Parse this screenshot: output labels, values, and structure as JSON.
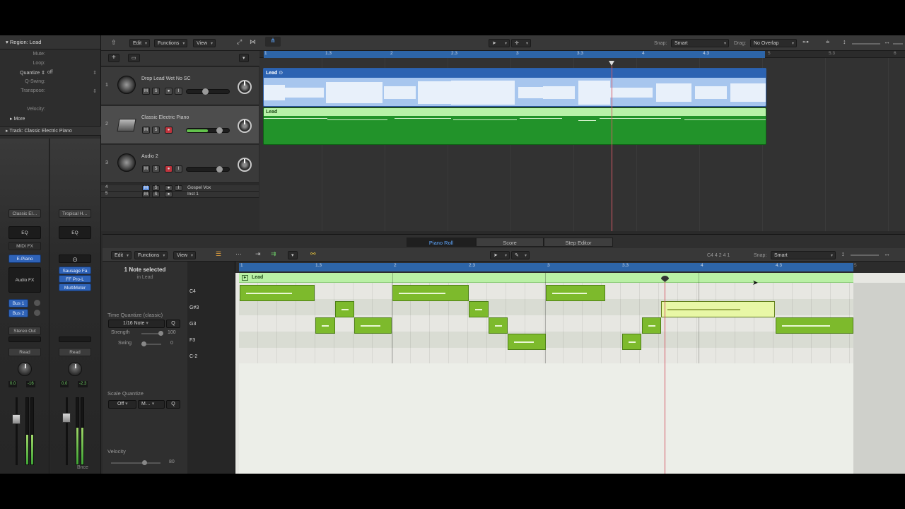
{
  "inspector": {
    "region_header": "Region: Lead",
    "mute_label": "Mute:",
    "loop_label": "Loop:",
    "quantize_label": "Quantize ⇕",
    "quantize_value": "off",
    "qswing_label": "Q-Swing:",
    "transpose_label": "Transpose:",
    "velocity_label": "Velocity:",
    "more_label": "More",
    "track_header": "Track: Classic Electric Piano"
  },
  "strip1": {
    "setting": "Classic El…",
    "eq": "EQ",
    "midi_fx": "MIDI FX",
    "instrument": "E-Piano",
    "audio_fx": "Audio FX",
    "send1": "Bus 1",
    "send2": "Bus 2",
    "output": "Stereo Out",
    "automation": "Read",
    "level_a": "0.0",
    "level_b": "-16"
  },
  "strip2": {
    "setting": "Tropical H…",
    "eq": "EQ",
    "fx": [
      "Sausage Fa",
      "FF Pro-L",
      "MultiMeter"
    ],
    "automation": "Read",
    "level_a": "0.0",
    "level_b": "-2.3",
    "bottom": "Bnce"
  },
  "arrange_toolbar": {
    "edit": "Edit",
    "functions": "Functions",
    "view": "View",
    "snap_label": "Snap:",
    "snap_value": "Smart",
    "drag_label": "Drag:",
    "drag_value": "No Overlap"
  },
  "ruler": [
    "1",
    "1.3",
    "2",
    "2.3",
    "3",
    "3.3",
    "4",
    "4.3",
    "5",
    "5.3",
    "6"
  ],
  "tracks": [
    {
      "num": "1",
      "name": "Drop Lead Wet No SC",
      "m": "M",
      "s": "S",
      "i": "I"
    },
    {
      "num": "2",
      "name": "Classic Electric Piano",
      "m": "M",
      "s": "S"
    },
    {
      "num": "3",
      "name": "Audio 2",
      "m": "M",
      "s": "S",
      "i": "I"
    },
    {
      "num": "4",
      "name": "Gospel Vox",
      "m": "M",
      "s": "S",
      "i": "I"
    },
    {
      "num": "5",
      "name": "Inst 1",
      "m": "M",
      "s": "S"
    }
  ],
  "regions": {
    "audio_name": "Lead",
    "midi_name": "Lead"
  },
  "editor_tabs": [
    "Piano Roll",
    "Score",
    "Step Editor"
  ],
  "piano_roll": {
    "edit": "Edit",
    "functions": "Functions",
    "view": "View",
    "position": "C4  4 2 4 1",
    "snap_label": "Snap:",
    "snap_value": "Smart",
    "selection": "1 Note selected",
    "selection_sub": "in Lead",
    "time_quantize_label": "Time Quantize (classic)",
    "quantize_value": "1/16 Note",
    "q_button": "Q",
    "strength_label": "Strength",
    "strength_value": "100",
    "swing_label": "Swing",
    "swing_value": "0",
    "scale_quantize_label": "Scale Quantize",
    "scale_off": "Off",
    "scale_mode": "M…",
    "velocity_label": "Velocity",
    "velocity_value": "80",
    "region_name": "Lead",
    "ruler": [
      "1",
      "1.3",
      "2",
      "2.3",
      "3",
      "3.3",
      "4",
      "4.3",
      "5"
    ],
    "keys": [
      "C4",
      "G#3",
      "G3",
      "F3",
      "C-2"
    ]
  }
}
